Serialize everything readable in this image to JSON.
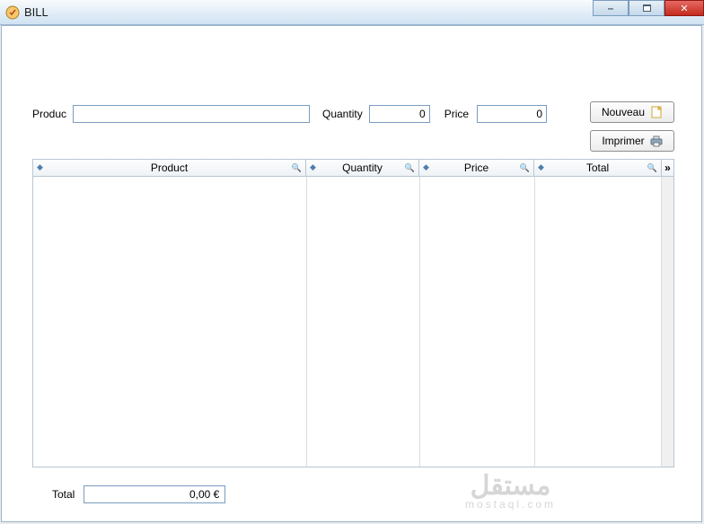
{
  "window": {
    "title": "BILL"
  },
  "form": {
    "product_label": "Produc",
    "product_value": "",
    "quantity_label": "Quantity",
    "quantity_value": "0",
    "price_label": "Price",
    "price_value": "0"
  },
  "buttons": {
    "new_label": "Nouveau",
    "print_label": "Imprimer"
  },
  "table": {
    "columns": {
      "product": "Product",
      "quantity": "Quantity",
      "price": "Price",
      "total": "Total"
    }
  },
  "footer": {
    "total_label": "Total",
    "total_value": "0,00 €"
  },
  "watermark": {
    "line1": "مستقل",
    "line2": "mostaql.com"
  }
}
